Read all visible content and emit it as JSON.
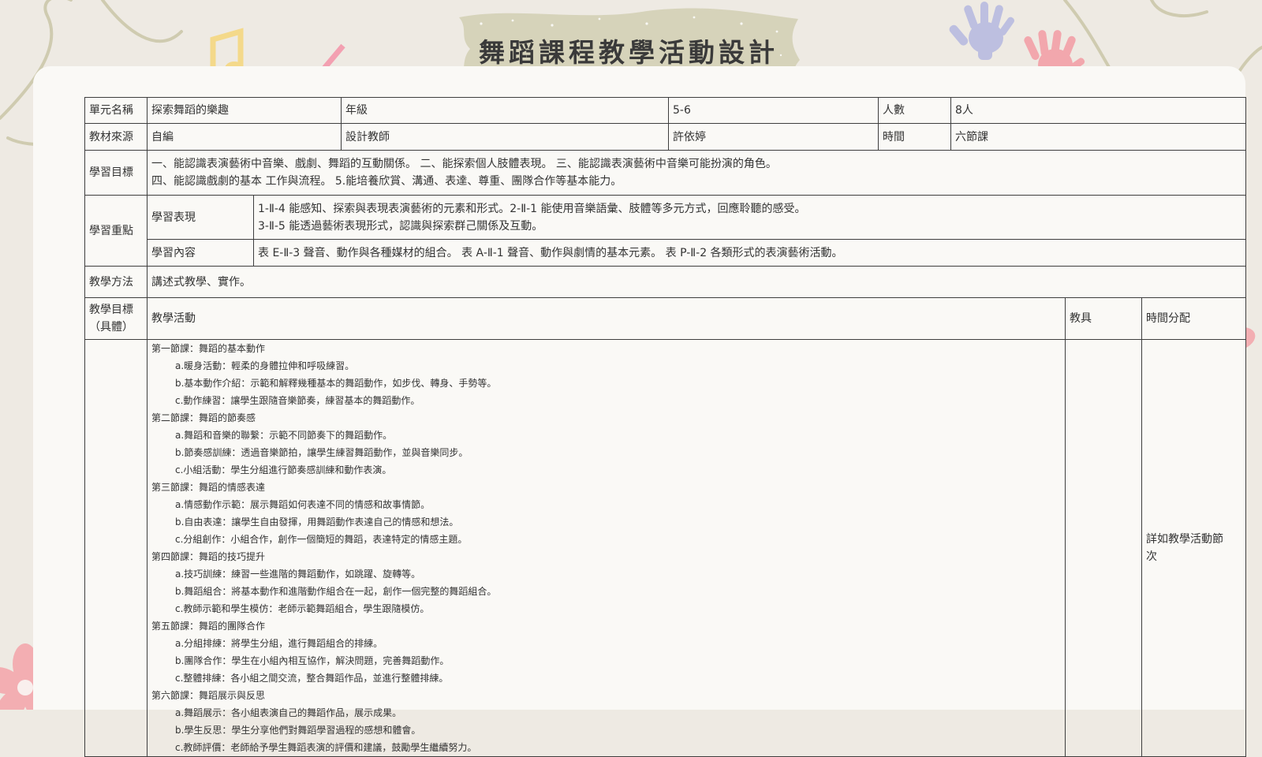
{
  "title": "舞蹈課程教學活動設計",
  "colors": {
    "background": "#eeeae3",
    "card": "#faf9f6",
    "title_banner": "#d6d3ba",
    "border": "#3e3e3e",
    "text": "#333333"
  },
  "icons": [
    "music-notes-icon",
    "handprints-icon",
    "flower-icon",
    "swirl-line-icon"
  ],
  "info": {
    "unit_label": "單元名稱",
    "unit_value": "探索舞蹈的樂趣",
    "grade_label": "年級",
    "grade_value": "5-6",
    "count_label": "人數",
    "count_value": "8人",
    "source_label": "教材來源",
    "source_value": "自編",
    "teacher_label": "設計教師",
    "teacher_value": "許依婷",
    "time_label": "時間",
    "time_value": "六節課"
  },
  "goals": {
    "label": "學習目標",
    "lines": [
      "一、能認識表演藝術中音樂、戲劇、舞蹈的互動關係。 二、能探索個人肢體表現。 三、能認識表演藝術中音樂可能扮演的角色。",
      "四、能認識戲劇的基本 工作與流程。 5.能培養欣賞、溝通、表達、尊重、團隊合作等基本能力。"
    ]
  },
  "focus": {
    "label": "學習重點",
    "performance_label": "學習表現",
    "performance_lines": [
      "1-Ⅱ-4 能感知、探索與表現表演藝術的元素和形式。2-Ⅱ-1 能使用音樂語彙、肢體等多元方式，回應聆聽的感受。",
      "3-Ⅱ-5 能透過藝術表現形式，認識與探索群己關係及互動。"
    ],
    "content_label": "學習內容",
    "content_value": "表 E-Ⅱ-3 聲音、動作與各種媒材的組合。 表 A-Ⅱ-1 聲音、動作與劇情的基本元素。 表 P-Ⅱ-2 各類形式的表演藝術活動。"
  },
  "method": {
    "label": "教學方法",
    "value": "講述式教學、實作。"
  },
  "activity_header": {
    "objective_label_1": "教學目標",
    "objective_label_2": "（具體）",
    "activity_label": "教學活動",
    "tools_label": "教具",
    "time_alloc_label": "時間分配"
  },
  "time_alloc_value_1": "詳如教學活動節",
  "time_alloc_value_2": "次",
  "lessons": [
    {
      "title": "第一節課：舞蹈的基本動作",
      "steps": [
        "a.暖身活動：輕柔的身體拉伸和呼吸練習。",
        "b.基本動作介紹：示範和解釋幾種基本的舞蹈動作，如步伐、轉身、手勢等。",
        "c.動作練習：讓學生跟隨音樂節奏，練習基本的舞蹈動作。"
      ]
    },
    {
      "title": "第二節課：舞蹈的節奏感",
      "steps": [
        "a.舞蹈和音樂的聯繫：示範不同節奏下的舞蹈動作。",
        "b.節奏感訓練：透過音樂節拍，讓學生練習舞蹈動作，並與音樂同步。",
        "c.小組活動：學生分組進行節奏感訓練和動作表演。"
      ]
    },
    {
      "title": "第三節課：舞蹈的情感表達",
      "steps": [
        "a.情感動作示範：展示舞蹈如何表達不同的情感和故事情節。",
        "b.自由表達：讓學生自由發揮，用舞蹈動作表達自己的情感和想法。",
        "c.分組創作：小組合作，創作一個簡短的舞蹈，表達特定的情感主題。"
      ]
    },
    {
      "title": "第四節課：舞蹈的技巧提升",
      "steps": [
        "a.技巧訓練：練習一些進階的舞蹈動作，如跳躍、旋轉等。",
        "b.舞蹈組合：將基本動作和進階動作組合在一起，創作一個完整的舞蹈組合。",
        "c.教師示範和學生模仿：老師示範舞蹈組合，學生跟隨模仿。"
      ]
    },
    {
      "title": "第五節課：舞蹈的團隊合作",
      "steps": [
        "a.分組排練：將學生分組，進行舞蹈組合的排練。",
        "b.團隊合作：學生在小組內相互協作，解決問題，完善舞蹈動作。",
        "c.整體排練：各小組之間交流，整合舞蹈作品，並進行整體排練。"
      ]
    },
    {
      "title": "第六節課：舞蹈展示與反思",
      "steps": [
        "a.舞蹈展示：各小組表演自己的舞蹈作品，展示成果。",
        "b.學生反思：學生分享他們對舞蹈學習過程的感想和體會。",
        "c.教師評價：老師給予學生舞蹈表演的評價和建議，鼓勵學生繼續努力。"
      ]
    }
  ]
}
